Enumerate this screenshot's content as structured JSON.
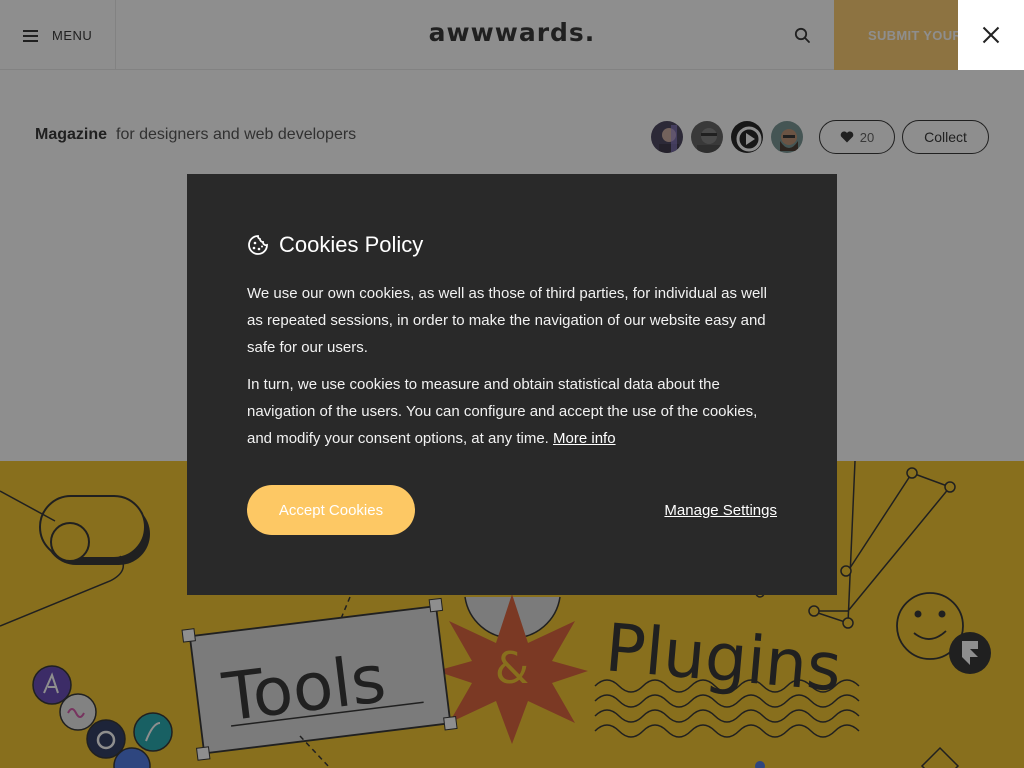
{
  "header": {
    "menu_label": "MENU",
    "logo_text": "awwwards.",
    "submit_label": "SUBMIT YOUR SITE"
  },
  "subbar": {
    "title": "Magazine",
    "subtitle": "for designers and web developers",
    "like_count": "20",
    "collect_label": "Collect"
  },
  "hero": {
    "word_tools": "Tools",
    "ampersand": "&",
    "word_plugins": "Plugins"
  },
  "cookie_modal": {
    "title": "Cookies Policy",
    "paragraph_1": "We use our own cookies, as well as those of third parties, for individual as well as repeated sessions, in order to make the navigation of our website easy and safe for our users.",
    "paragraph_2": "In turn, we use cookies to measure and obtain statistical data about the navigation of the users. You can configure and accept the use of the cookies, and modify your consent options, at any time.",
    "more_info_label": "More info",
    "accept_label": "Accept Cookies",
    "manage_label": "Manage Settings"
  },
  "colors": {
    "accent_yellow": "#fdc864",
    "hero_yellow": "#f3c01c",
    "modal_bg": "#292929",
    "burst_red": "#d9542b"
  },
  "icons": [
    "menu-icon",
    "search-icon",
    "close-icon",
    "heart-icon",
    "cookie-icon"
  ]
}
